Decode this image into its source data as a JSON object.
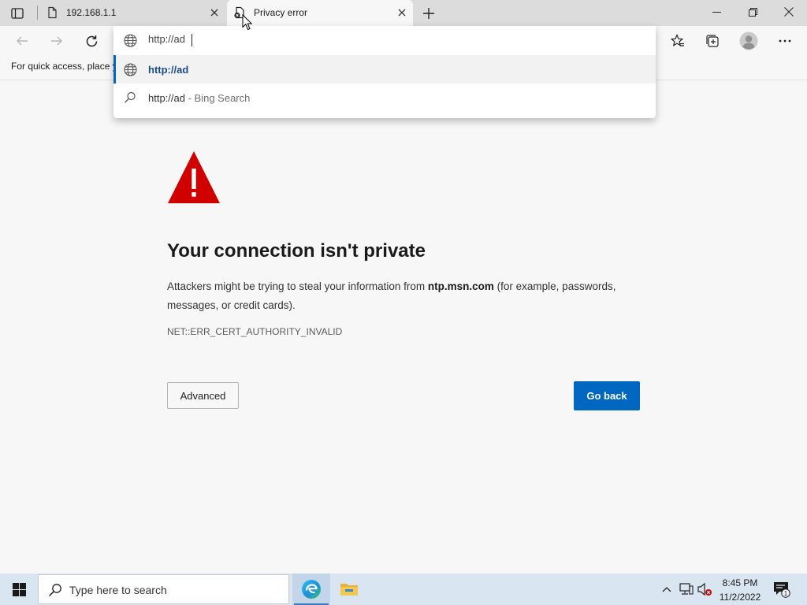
{
  "browser": {
    "tabs": [
      {
        "title": "192.168.1.1",
        "icon": "page-icon",
        "active": false
      },
      {
        "title": "Privacy error",
        "icon": "warning-page-icon",
        "active": true
      }
    ],
    "favorites_bar_text": "For quick access, place y"
  },
  "omnibox": {
    "value": "http://ad",
    "suggestions": [
      {
        "text": "http://ad",
        "icon": "globe-icon",
        "selected": true
      },
      {
        "text": "http://ad",
        "suffix": " - Bing Search",
        "icon": "search-icon",
        "selected": false
      }
    ]
  },
  "page": {
    "heading": "Your connection isn't private",
    "desc_prefix": "Attackers might be trying to steal your information from ",
    "desc_host": "ntp.msn.com",
    "desc_suffix": " (for example, passwords, messages, or credit cards).",
    "error_code": "NET::ERR_CERT_AUTHORITY_INVALID",
    "advanced_label": "Advanced",
    "go_back_label": "Go back"
  },
  "taskbar": {
    "search_placeholder": "Type here to search",
    "time": "8:45 PM",
    "date": "11/2/2022",
    "notification_count": "1"
  },
  "colors": {
    "accent": "#0067c0",
    "warning": "#d10000",
    "taskbar": "#d9e6f2"
  }
}
